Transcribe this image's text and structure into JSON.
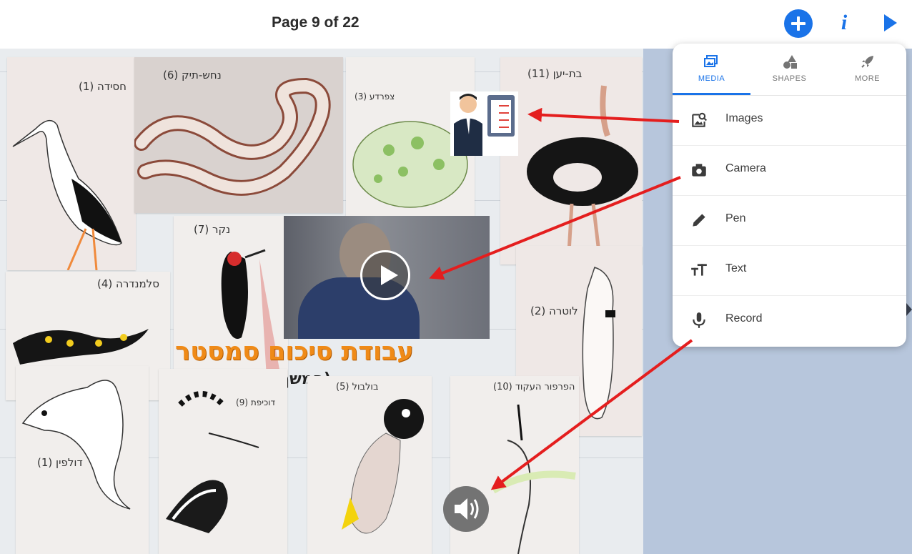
{
  "header": {
    "page_indicator": "Page 9 of 22",
    "add_button_icon": "plus-icon",
    "info_button_label": "i",
    "play_button_icon": "play-icon"
  },
  "board": {
    "title": "עבודת סיכום סמסטר",
    "subtitle": "(המשך בעמוד הבא)",
    "cards": [
      {
        "label": "חסידה (1)"
      },
      {
        "label": "נחש-תיק (6)"
      },
      {
        "label": "צפרדע (3)"
      },
      {
        "label": "בת-יען (11)"
      },
      {
        "label": "נקר (7)"
      },
      {
        "label": "סלמנדרה (4)"
      },
      {
        "label": "לוטרה (2)"
      },
      {
        "label": "דולפין (1)"
      },
      {
        "label": "דוכיפת (9)"
      },
      {
        "label": "בולבול (5)"
      },
      {
        "label": "הפרפור העקוד (10)"
      }
    ]
  },
  "menu": {
    "tabs": [
      {
        "label": "MEDIA",
        "icon": "media-icon",
        "active": true
      },
      {
        "label": "SHAPES",
        "icon": "shapes-icon",
        "active": false
      },
      {
        "label": "MORE",
        "icon": "rocket-icon",
        "active": false
      }
    ],
    "items": [
      {
        "label": "Images",
        "icon": "image-search-icon"
      },
      {
        "label": "Camera",
        "icon": "camera-icon"
      },
      {
        "label": "Pen",
        "icon": "pen-icon"
      },
      {
        "label": "Text",
        "icon": "text-icon"
      },
      {
        "label": "Record",
        "icon": "microphone-icon"
      }
    ]
  },
  "colors": {
    "accent": "#1a73e8",
    "arrow": "#e41e1e",
    "title_orange": "#ef8a17"
  }
}
